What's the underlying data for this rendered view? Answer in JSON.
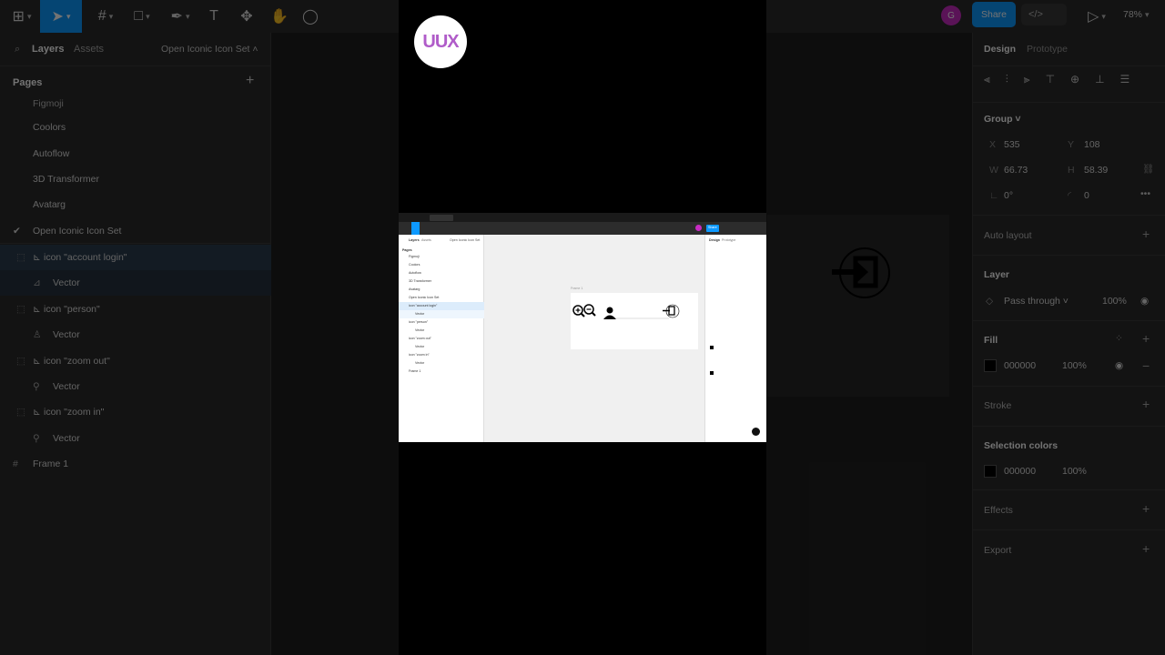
{
  "toolbar": {
    "share_label": "Share",
    "zoom": "78%",
    "avatar_initial": "G"
  },
  "left_panel": {
    "tabs": [
      "Layers",
      "Assets"
    ],
    "page_selector": "Open Iconic Icon Set",
    "pages_title": "Pages",
    "pages": [
      "Figmoji",
      "Coolors",
      "Autoflow",
      "3D Transformer",
      "Avatarg",
      "Open Iconic Icon Set"
    ],
    "layers": [
      {
        "label": "icon \"account login\"",
        "kind": "group"
      },
      {
        "label": "Vector",
        "kind": "vector"
      },
      {
        "label": "icon \"person\"",
        "kind": "group"
      },
      {
        "label": "Vector",
        "kind": "vector"
      },
      {
        "label": "icon \"zoom out\"",
        "kind": "group"
      },
      {
        "label": "Vector",
        "kind": "vector"
      },
      {
        "label": "icon \"zoom in\"",
        "kind": "group"
      },
      {
        "label": "Vector",
        "kind": "vector"
      },
      {
        "label": "Frame 1",
        "kind": "frame"
      }
    ]
  },
  "right_panel": {
    "tabs": [
      "Design",
      "Prototype"
    ],
    "group_label": "Group",
    "x_label": "X",
    "x": "535",
    "y_label": "Y",
    "y": "108",
    "w_label": "W",
    "w": "66.73",
    "h_label": "H",
    "h": "58.39",
    "rotation": "0°",
    "radius": "0",
    "auto_layout": "Auto layout",
    "layer_title": "Layer",
    "blend_mode": "Pass through",
    "layer_opacity": "100%",
    "fill_title": "Fill",
    "fill_hex": "000000",
    "fill_opacity": "100%",
    "stroke_title": "Stroke",
    "selection_colors_title": "Selection colors",
    "sel_hex": "000000",
    "sel_opacity": "100%",
    "effects_title": "Effects",
    "export_title": "Export"
  },
  "video": {
    "logo_text": "UUX",
    "mini": {
      "tabs": [
        "Layers",
        "Assets"
      ],
      "page_selector": "Open Iconic Icon Set",
      "pages_title": "Pages",
      "pages": [
        "Figmoji",
        "Coolors",
        "Autoflow",
        "3D Transformer",
        "Avatarg",
        "Open Iconic Icon Set"
      ],
      "layers": [
        "icon \"account login\"",
        "Vector",
        "icon \"person\"",
        "Vector",
        "icon \"zoom out\"",
        "Vector",
        "icon \"zoom in\"",
        "Vector",
        "Frame 1"
      ],
      "frame_label": "Frame 1",
      "share": "Share",
      "design_tabs": [
        "Design",
        "Prototype"
      ]
    }
  },
  "colors": {
    "accent": "#0d99ff",
    "avatar": "#c72bc2",
    "logo_purple": "#b05cc9"
  }
}
